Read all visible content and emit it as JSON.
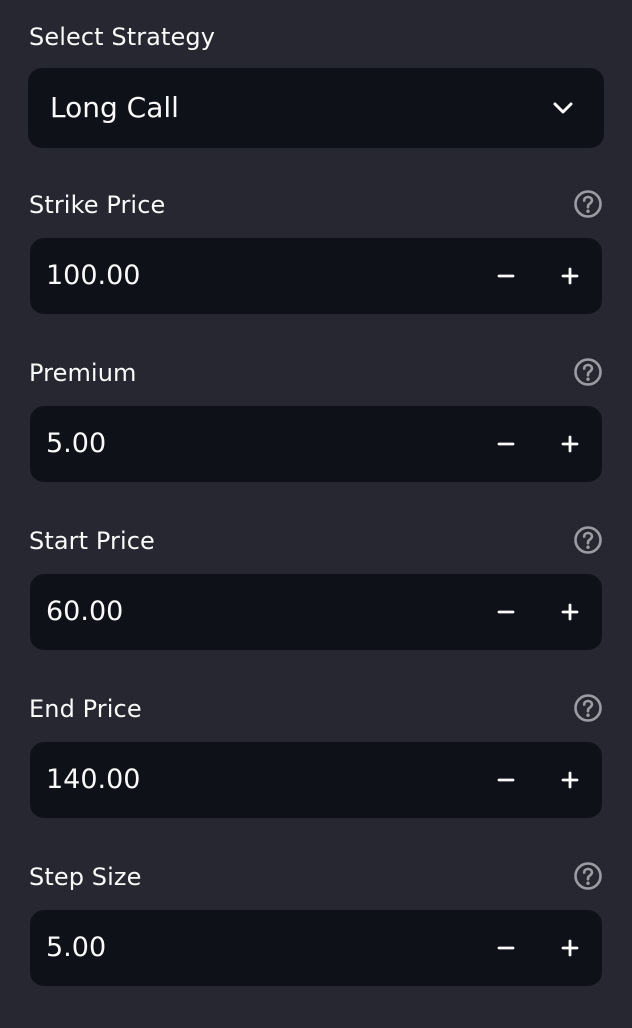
{
  "strategy": {
    "label": "Select Strategy",
    "selected": "Long Call",
    "icon": "chevron-down-icon"
  },
  "fields": [
    {
      "label": "Strike Price",
      "value": "100.00",
      "help_icon": "help-circle-icon",
      "minus_icon": "minus-icon",
      "plus_icon": "plus-icon"
    },
    {
      "label": "Premium",
      "value": "5.00",
      "help_icon": "help-circle-icon",
      "minus_icon": "minus-icon",
      "plus_icon": "plus-icon"
    },
    {
      "label": "Start Price",
      "value": "60.00",
      "help_icon": "help-circle-icon",
      "minus_icon": "minus-icon",
      "plus_icon": "plus-icon"
    },
    {
      "label": "End Price",
      "value": "140.00",
      "help_icon": "help-circle-icon",
      "minus_icon": "minus-icon",
      "plus_icon": "plus-icon"
    },
    {
      "label": "Step Size",
      "value": "5.00",
      "help_icon": "help-circle-icon",
      "minus_icon": "minus-icon",
      "plus_icon": "plus-icon"
    }
  ],
  "colors": {
    "background": "#262730",
    "input_background": "#0e1117",
    "text": "#fafafa",
    "icon_muted": "#9c9da3"
  }
}
